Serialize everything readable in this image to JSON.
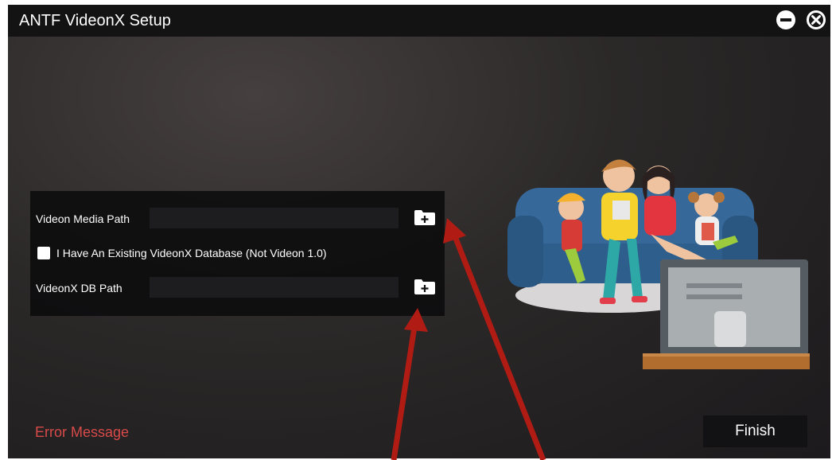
{
  "window": {
    "title": "ANTF VideonX Setup",
    "minimize_icon": "minus-circle-icon",
    "close_icon": "close-circle-icon"
  },
  "form": {
    "media_path_label": "Videon Media Path",
    "media_path_value": "",
    "existing_db_label": "I Have An Existing VideonX Database (Not Videon 1.0)",
    "existing_db_checked": false,
    "db_path_label": "VideonX DB Path",
    "db_path_value": "",
    "browse_icon": "folder-plus-icon"
  },
  "footer": {
    "error_message": "Error Message",
    "finish_label": "Finish"
  },
  "colors": {
    "error": "#d84a4a",
    "annotation_arrow": "#b01c14",
    "title_bar": "#141314"
  }
}
